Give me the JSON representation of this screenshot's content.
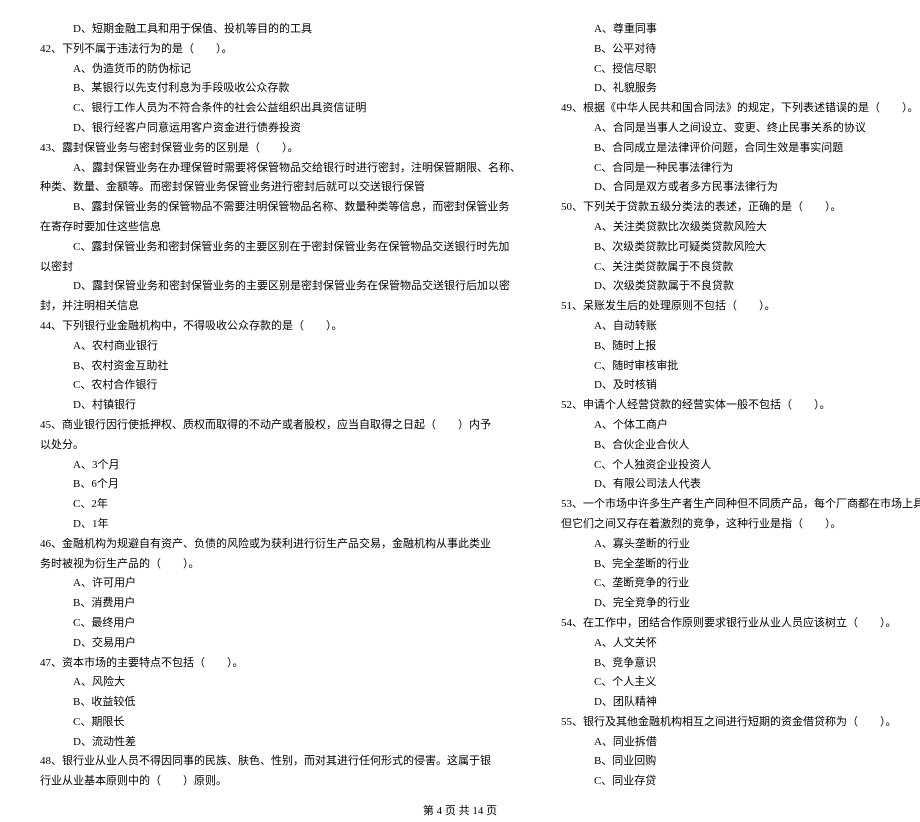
{
  "left": [
    {
      "cls": "indent2",
      "t": "D、短期金融工具和用于保值、投机等目的的工具"
    },
    {
      "cls": "",
      "t": "42、下列不属于违法行为的是（　　）。"
    },
    {
      "cls": "indent2",
      "t": "A、伪造货币的防伪标记"
    },
    {
      "cls": "indent2",
      "t": "B、某银行以先支付利息为手段吸收公众存款"
    },
    {
      "cls": "indent2",
      "t": "C、银行工作人员为不符合条件的社会公益组织出具资信证明"
    },
    {
      "cls": "indent2",
      "t": "D、银行经客户同意运用客户资金进行债券投资"
    },
    {
      "cls": "",
      "t": "43、露封保管业务与密封保管业务的区别是（　　）。"
    },
    {
      "cls": "indent2",
      "t": "A、露封保管业务在办理保管时需要将保管物品交给银行时进行密封，注明保管期限、名称、"
    },
    {
      "cls": "",
      "t": "种类、数量、金额等。而密封保管业务保管业务进行密封后就可以交送银行保管"
    },
    {
      "cls": "indent2",
      "t": "B、露封保管业务的保管物品不需要注明保管物品名称、数量种类等信息，而密封保管业务"
    },
    {
      "cls": "",
      "t": "在寄存时要加住这些信息"
    },
    {
      "cls": "indent2",
      "t": "C、露封保管业务和密封保管业务的主要区别在于密封保管业务在保管物品交送银行时先加"
    },
    {
      "cls": "",
      "t": "以密封"
    },
    {
      "cls": "indent2",
      "t": "D、露封保管业务和密封保管业务的主要区别是密封保管业务在保管物品交送银行后加以密"
    },
    {
      "cls": "",
      "t": "封，并注明相关信息"
    },
    {
      "cls": "",
      "t": "44、下列银行业金融机构中，不得吸收公众存款的是（　　）。"
    },
    {
      "cls": "indent2",
      "t": "A、农村商业银行"
    },
    {
      "cls": "indent2",
      "t": "B、农村资金互助社"
    },
    {
      "cls": "indent2",
      "t": "C、农村合作银行"
    },
    {
      "cls": "indent2",
      "t": "D、村镇银行"
    },
    {
      "cls": "",
      "t": "45、商业银行因行使抵押权、质权而取得的不动产或者股权，应当自取得之日起（　　）内予"
    },
    {
      "cls": "",
      "t": "以处分。"
    },
    {
      "cls": "indent2",
      "t": "A、3个月"
    },
    {
      "cls": "indent2",
      "t": "B、6个月"
    },
    {
      "cls": "indent2",
      "t": "C、2年"
    },
    {
      "cls": "indent2",
      "t": "D、1年"
    },
    {
      "cls": "",
      "t": "46、金融机构为规避自有资产、负债的风险或为获利进行衍生产品交易，金融机构从事此类业"
    },
    {
      "cls": "",
      "t": "务时被视为衍生产品的（　　）。"
    },
    {
      "cls": "indent2",
      "t": "A、许可用户"
    },
    {
      "cls": "indent2",
      "t": "B、消费用户"
    },
    {
      "cls": "indent2",
      "t": "C、最终用户"
    },
    {
      "cls": "indent2",
      "t": "D、交易用户"
    },
    {
      "cls": "",
      "t": "47、资本市场的主要特点不包括（　　）。"
    },
    {
      "cls": "indent2",
      "t": "A、风险大"
    },
    {
      "cls": "indent2",
      "t": "B、收益较低"
    },
    {
      "cls": "indent2",
      "t": "C、期限长"
    },
    {
      "cls": "indent2",
      "t": "D、流动性差"
    },
    {
      "cls": "",
      "t": "48、银行业从业人员不得因同事的民族、肤色、性别，而对其进行任何形式的侵害。这属于银"
    },
    {
      "cls": "",
      "t": "行业从业基本原则中的（　　）原则。"
    }
  ],
  "right": [
    {
      "cls": "indent2",
      "t": "A、尊重同事"
    },
    {
      "cls": "indent2",
      "t": "B、公平对待"
    },
    {
      "cls": "indent2",
      "t": "C、授信尽职"
    },
    {
      "cls": "indent2",
      "t": "D、礼貌服务"
    },
    {
      "cls": "",
      "t": "49、根据《中华人民共和国合同法》的规定，下列表述错误的是（　　）。"
    },
    {
      "cls": "indent2",
      "t": "A、合同是当事人之间设立、变更、终止民事关系的协议"
    },
    {
      "cls": "indent2",
      "t": "B、合同成立是法律评价问题，合同生效是事实问题"
    },
    {
      "cls": "indent2",
      "t": "C、合同是一种民事法律行为"
    },
    {
      "cls": "indent2",
      "t": "D、合同是双方或者多方民事法律行为"
    },
    {
      "cls": "",
      "t": "50、下列关于贷款五级分类法的表述，正确的是（　　）。"
    },
    {
      "cls": "indent2",
      "t": "A、关注类贷款比次级类贷款风险大"
    },
    {
      "cls": "indent2",
      "t": "B、次级类贷款比可疑类贷款风险大"
    },
    {
      "cls": "indent2",
      "t": "C、关注类贷款属于不良贷款"
    },
    {
      "cls": "indent2",
      "t": "D、次级类贷款属于不良贷款"
    },
    {
      "cls": "",
      "t": "51、呆账发生后的处理原则不包括（　　）。"
    },
    {
      "cls": "indent2",
      "t": "A、自动转账"
    },
    {
      "cls": "indent2",
      "t": "B、随时上报"
    },
    {
      "cls": "indent2",
      "t": "C、随时审核审批"
    },
    {
      "cls": "indent2",
      "t": "D、及时核销"
    },
    {
      "cls": "",
      "t": "52、申请个人经营贷款的经营实体一般不包括（　　）。"
    },
    {
      "cls": "indent2",
      "t": "A、个体工商户"
    },
    {
      "cls": "indent2",
      "t": "B、合伙企业合伙人"
    },
    {
      "cls": "indent2",
      "t": "C、个人独资企业投资人"
    },
    {
      "cls": "indent2",
      "t": "D、有限公司法人代表"
    },
    {
      "cls": "",
      "t": "53、一个市场中许多生产者生产同种但不同质产品，每个厂商都在市场上具有一定的垄断能力，"
    },
    {
      "cls": "",
      "t": "但它们之间又存在着激烈的竞争，这种行业是指（　　）。"
    },
    {
      "cls": "indent2",
      "t": "A、寡头垄断的行业"
    },
    {
      "cls": "indent2",
      "t": "B、完全垄断的行业"
    },
    {
      "cls": "indent2",
      "t": "C、垄断竞争的行业"
    },
    {
      "cls": "indent2",
      "t": "D、完全竞争的行业"
    },
    {
      "cls": "",
      "t": "54、在工作中，团结合作原则要求银行业从业人员应该树立（　　）。"
    },
    {
      "cls": "indent2",
      "t": "A、人文关怀"
    },
    {
      "cls": "indent2",
      "t": "B、竞争意识"
    },
    {
      "cls": "indent2",
      "t": "C、个人主义"
    },
    {
      "cls": "indent2",
      "t": "D、团队精神"
    },
    {
      "cls": "",
      "t": "55、银行及其他金融机构相互之间进行短期的资金借贷称为（　　）。"
    },
    {
      "cls": "indent2",
      "t": "A、同业拆借"
    },
    {
      "cls": "indent2",
      "t": "B、同业回购"
    },
    {
      "cls": "indent2",
      "t": "C、同业存贷"
    }
  ],
  "footer": "第 4 页 共 14 页"
}
